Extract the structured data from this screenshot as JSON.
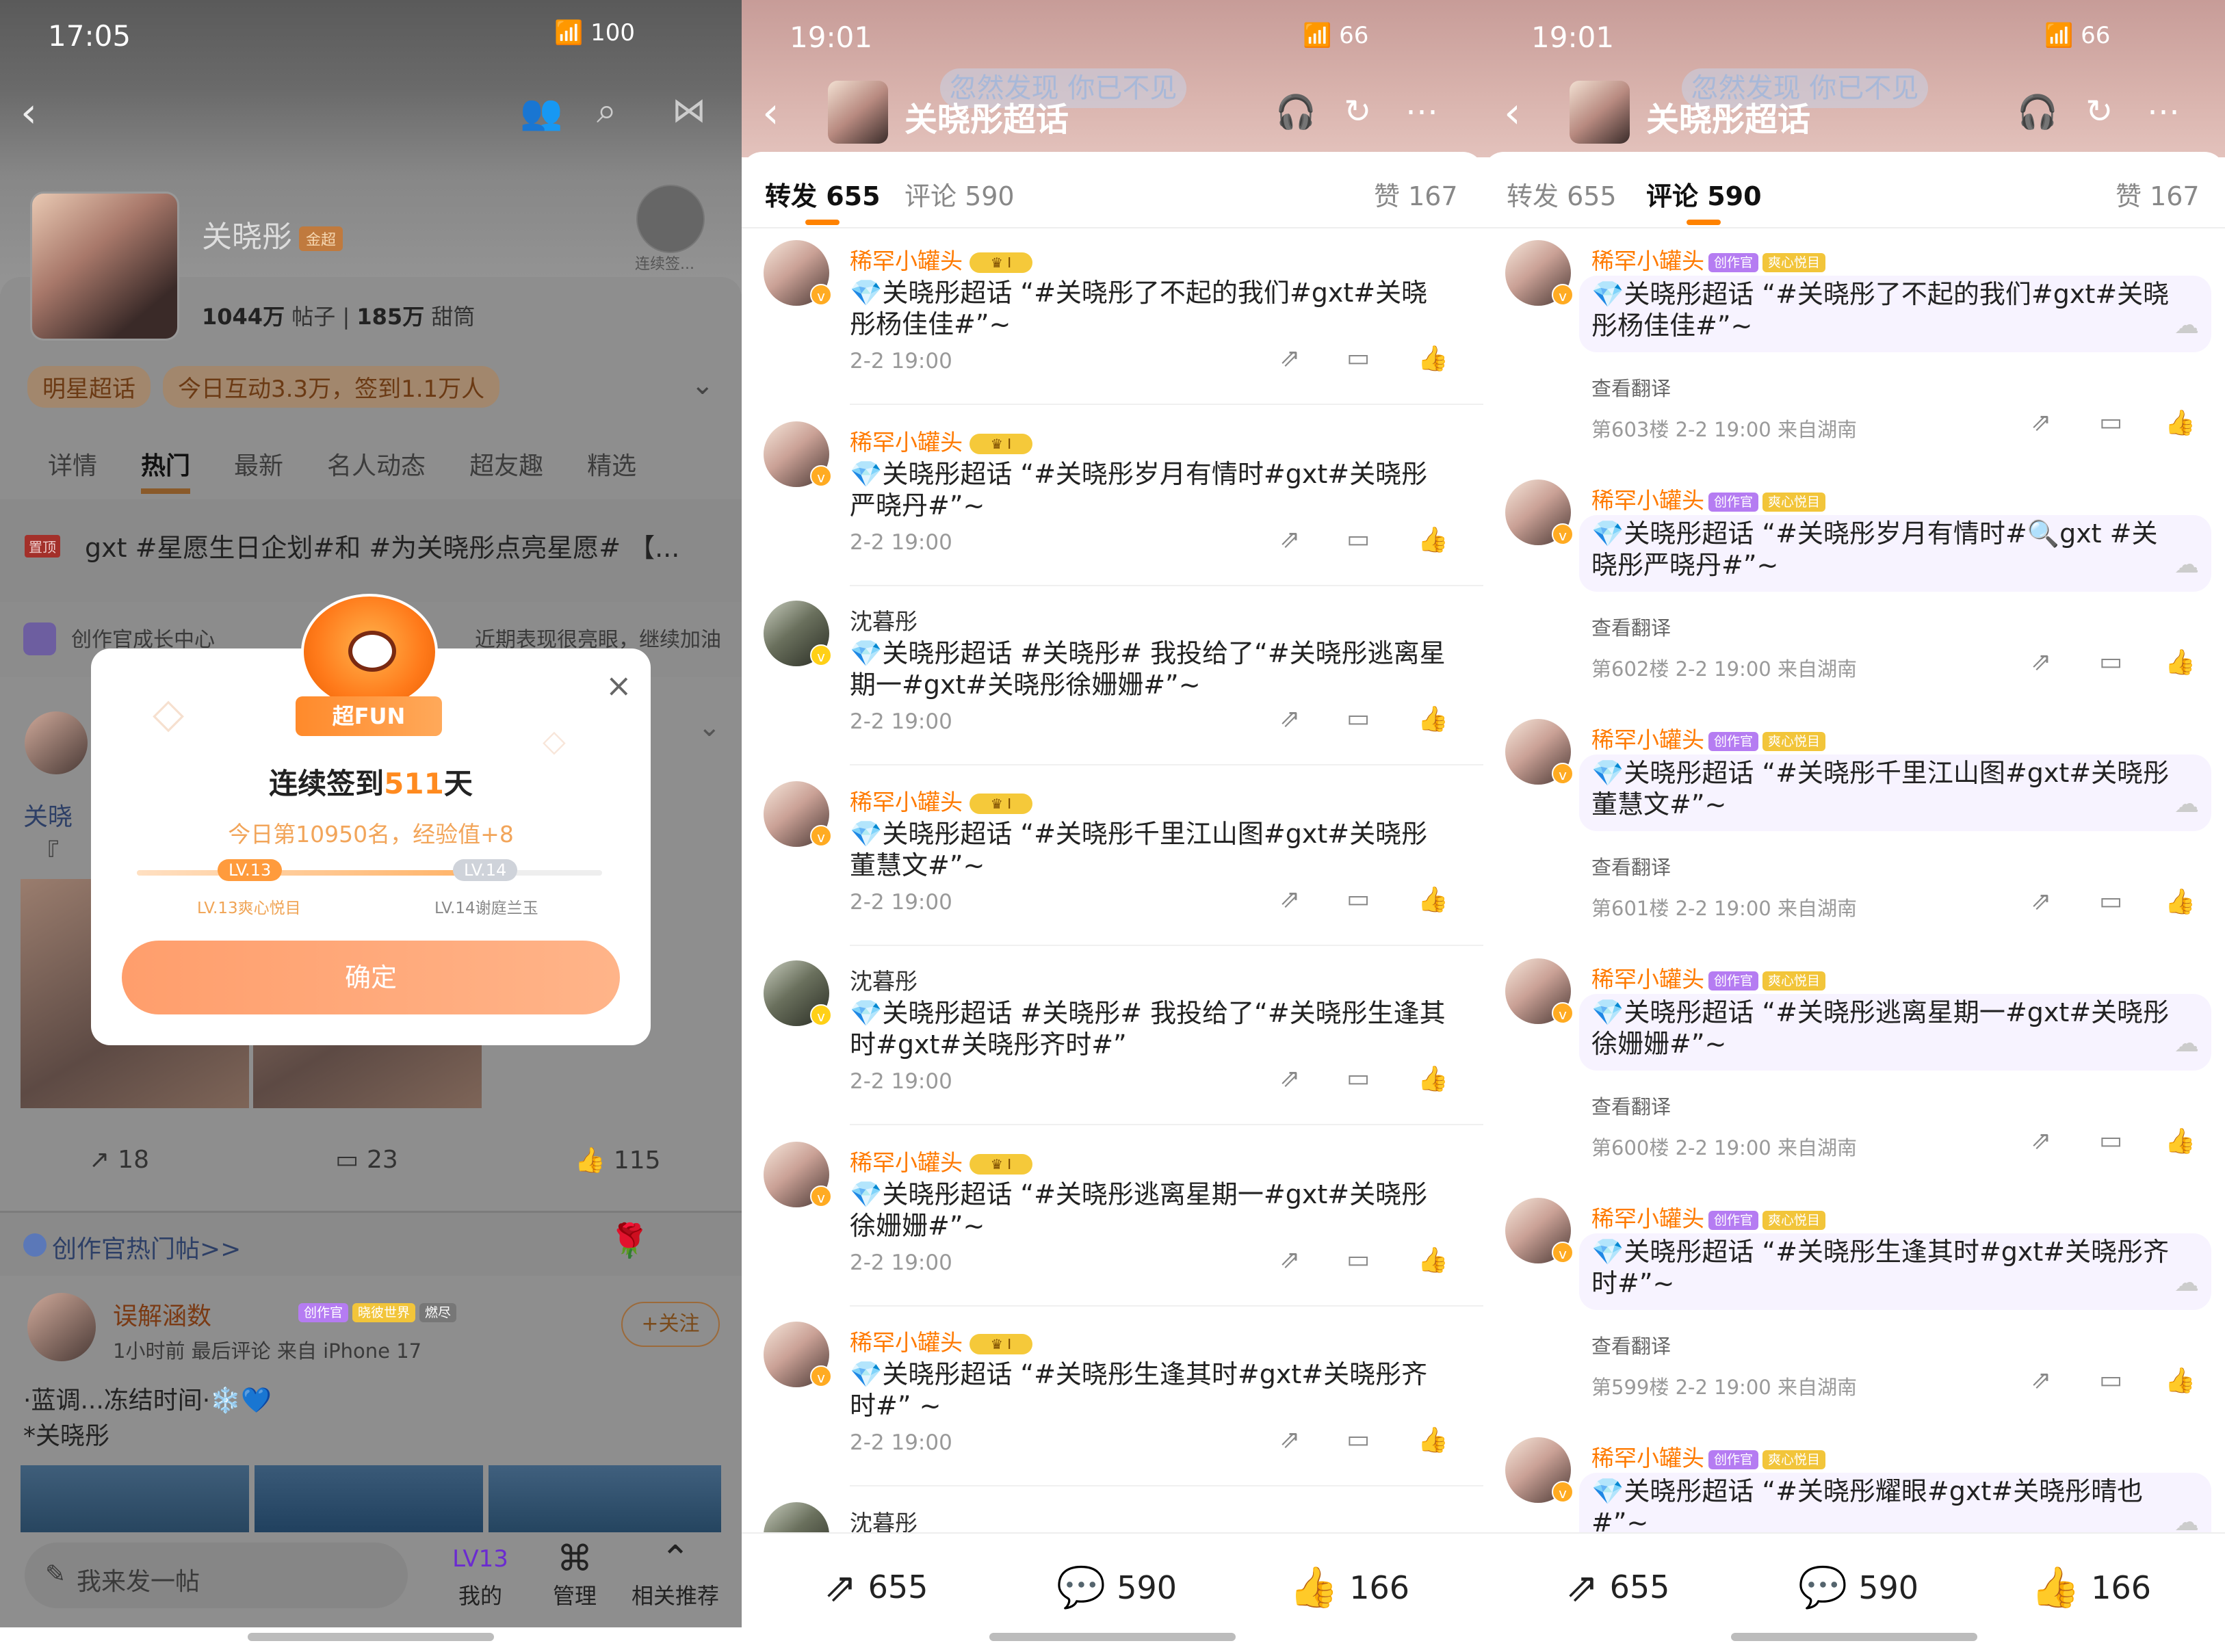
{
  "p1": {
    "time": "17:05",
    "battery": "100",
    "name": "关晓彤",
    "name_badge": "金超",
    "posts": "1044万",
    "posts_label": "帖子",
    "fans": "185万",
    "fans_label": "甜筒",
    "checkin_label": "连续签...",
    "tag1": "明星超话",
    "tag2": "今日互动3.3万，签到1.1万人",
    "tabs": [
      "详情",
      "热门",
      "最新",
      "名人动态",
      "超友趣",
      "精选"
    ],
    "pin_label": "置顶",
    "pin_text": "gxt #星愿生日企划#和 #为关晓彤点亮星愿# 【...",
    "creator_center": "创作官成长中心",
    "creator_right": "近期表现很亮眼，继续加油",
    "post_snip1": "关晓",
    "post_snip2": "『",
    "share_count": "18",
    "comment_count": "23",
    "like_count": "115",
    "hot_posts": "创作官热门帖>>",
    "user2": "误解涵数",
    "user2_badge1": "创作官",
    "user2_badge2": "晓彼世界",
    "user2_badge3": "燃尽",
    "user2_meta": "1小时前 最后评论   来自 iPhone 17",
    "follow": "+关注",
    "post2_line1": "·蓝调...冻结时间·❄️💙",
    "post2_line2": "*关晓彤",
    "post_input": "我来发一帖",
    "btn_mine": "我的",
    "btn_mine_lv": "LV13",
    "btn_manage": "管理",
    "btn_related": "相关推荐",
    "modal": {
      "badge": "超FUN",
      "title_pre": "连续签到",
      "title_num": "511",
      "title_post": "天",
      "sub": "今日第10950名，经验值+8",
      "lv_current": "LV.13",
      "lv_next": "LV.14",
      "lv_current_name": "LV.13爽心悦目",
      "lv_next_name": "LV.14谢庭兰玉",
      "progress": 0.7,
      "ok": "确定"
    }
  },
  "p2": {
    "time": "19:01",
    "battery": "66",
    "title": "关晓彤超话",
    "ghost": "忽然发现 你已不见",
    "tab_repost": "转发 655",
    "tab_comment": "评论 590",
    "tab_like": "赞 167",
    "items": [
      {
        "user": "稀罕小罐头",
        "crown": true,
        "text": "💎关晓彤超话 “#关晓彤了不起的我们#gxt#关晓彤杨佳佳#”~",
        "date": "2-2 19:00"
      },
      {
        "user": "稀罕小罐头",
        "crown": true,
        "text": "💎关晓彤超话 “#关晓彤岁月有情时#gxt#关晓彤严晓丹#”~",
        "date": "2-2 19:00"
      },
      {
        "user": "沈暮彤",
        "crown": false,
        "text": "💎关晓彤超话 #关晓彤# 我投给了“#关晓彤逃离星期一#gxt#关晓彤徐姗姗#”~",
        "date": "2-2 19:00"
      },
      {
        "user": "稀罕小罐头",
        "crown": true,
        "text": "💎关晓彤超话 “#关晓彤千里江山图#gxt#关晓彤董慧文#”~",
        "date": "2-2 19:00"
      },
      {
        "user": "沈暮彤",
        "crown": false,
        "text": "💎关晓彤超话 #关晓彤# 我投给了“#关晓彤生逢其时#gxt#关晓彤齐时#”",
        "date": "2-2 19:00"
      },
      {
        "user": "稀罕小罐头",
        "crown": true,
        "text": "💎关晓彤超话 “#关晓彤逃离星期一#gxt#关晓彤徐姗姗#”~",
        "date": "2-2 19:00"
      },
      {
        "user": "稀罕小罐头",
        "crown": true,
        "text": "💎关晓彤超话 “#关晓彤生逢其时#gxt#关晓彤齐时#” ~",
        "date": "2-2 19:00"
      },
      {
        "user": "沈暮彤",
        "crown": false,
        "text": "",
        "date": ""
      }
    ],
    "foot_share": "655",
    "foot_comment": "590",
    "foot_like": "166"
  },
  "p3": {
    "time": "19:01",
    "battery": "66",
    "title": "关晓彤超话",
    "ghost": "忽然发现 你已不见",
    "tab_repost": "转发 655",
    "tab_comment": "评论 590",
    "tab_like": "赞 167",
    "badge_cz": "创作官",
    "badge_sx": "爽心悦目",
    "translate": "查看翻译",
    "items": [
      {
        "user": "稀罕小罐头",
        "text": "💎关晓彤超话 “#关晓彤了不起的我们#gxt#关晓彤杨佳佳#”~",
        "meta": "第603楼 2-2 19:00 来自湖南"
      },
      {
        "user": "稀罕小罐头",
        "text": "💎关晓彤超话 “#关晓彤岁月有情时#🔍gxt #关晓彤严晓丹#”~",
        "meta": "第602楼 2-2 19:00 来自湖南"
      },
      {
        "user": "稀罕小罐头",
        "text": "💎关晓彤超话 “#关晓彤千里江山图#gxt#关晓彤董慧文#”~",
        "meta": "第601楼 2-2 19:00 来自湖南"
      },
      {
        "user": "稀罕小罐头",
        "text": "💎关晓彤超话 “#关晓彤逃离星期一#gxt#关晓彤徐姗姗#”~",
        "meta": "第600楼 2-2 19:00 来自湖南"
      },
      {
        "user": "稀罕小罐头",
        "text": "💎关晓彤超话 “#关晓彤生逢其时#gxt#关晓彤齐时#”~",
        "meta": "第599楼 2-2 19:00 来自湖南"
      },
      {
        "user": "稀罕小罐头",
        "text": "💎关晓彤超话 “#关晓彤耀眼#gxt#关晓彤晴也#”~",
        "meta": ""
      }
    ],
    "foot_share": "655",
    "foot_comment": "590",
    "foot_like": "166"
  },
  "colors": {
    "accent": "#ff8200",
    "link": "#2a5aa8",
    "username": "#ff7a00"
  }
}
